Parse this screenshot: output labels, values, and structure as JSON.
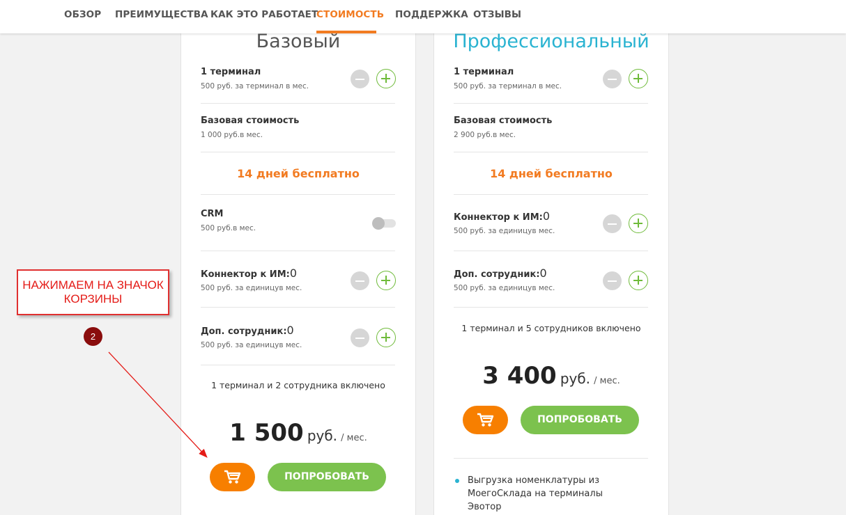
{
  "nav": {
    "items": [
      {
        "label": "ОБЗОР"
      },
      {
        "label": "ПРЕИМУЩЕСТВА"
      },
      {
        "label": "КАК ЭТО РАБОТАЕТ"
      },
      {
        "label": "СТОИМОСТЬ",
        "active": true
      },
      {
        "label": "ПОДДЕРЖКА"
      },
      {
        "label": "ОТЗЫВЫ"
      }
    ]
  },
  "colors": {
    "accent_orange": "#f27b21",
    "green": "#7cc24e",
    "title_blue": "#2ab3d1",
    "annotation_red": "#e41b17"
  },
  "plans": [
    {
      "title": "Базовый",
      "terminal": {
        "title": "1 терминал",
        "sub": "500 руб. за терминал в мес."
      },
      "base": {
        "title": "Базовая стоимость",
        "sub": "1 000 руб.в мес."
      },
      "free": "14 дней бесплатно",
      "crm": {
        "title": "CRM",
        "sub": "500 руб.в мес.",
        "enabled": false
      },
      "connector": {
        "title": "Коннектор к ИМ:",
        "count": "0",
        "sub": "500 руб. за единицув мес."
      },
      "staff": {
        "title": "Доп. сотрудник:",
        "count": "0",
        "sub": "500 руб. за единицув мес."
      },
      "included": "1 терминал и 2 сотрудника включено",
      "price": {
        "amount": "1 500",
        "currency": "руб.",
        "period": "/ мес."
      },
      "cart_icon": "cart-icon",
      "try_label": "ПОПРОБОВАТЬ"
    },
    {
      "title": "Профессиональный",
      "terminal": {
        "title": "1 терминал",
        "sub": "500 руб. за терминал в мес."
      },
      "base": {
        "title": "Базовая стоимость",
        "sub": "2 900 руб.в мес."
      },
      "free": "14 дней бесплатно",
      "connector": {
        "title": "Коннектор к ИМ:",
        "count": "0",
        "sub": "500 руб. за единицув мес."
      },
      "staff": {
        "title": "Доп. сотрудник:",
        "count": "0",
        "sub": "500 руб. за единицув мес."
      },
      "included": "1 терминал и 5 сотрудников включено",
      "price": {
        "amount": "3 400",
        "currency": "руб.",
        "period": "/ мес."
      },
      "cart_icon": "cart-icon",
      "try_label": "ПОПРОБОВАТЬ",
      "features": [
        "Выгрузка номенклатуры из МоегоСклада на терминалы Эвотор"
      ]
    }
  ],
  "annotation": {
    "text": "НАЖИМАЕМ НА ЗНАЧОК КОРЗИНЫ",
    "step": "2"
  }
}
